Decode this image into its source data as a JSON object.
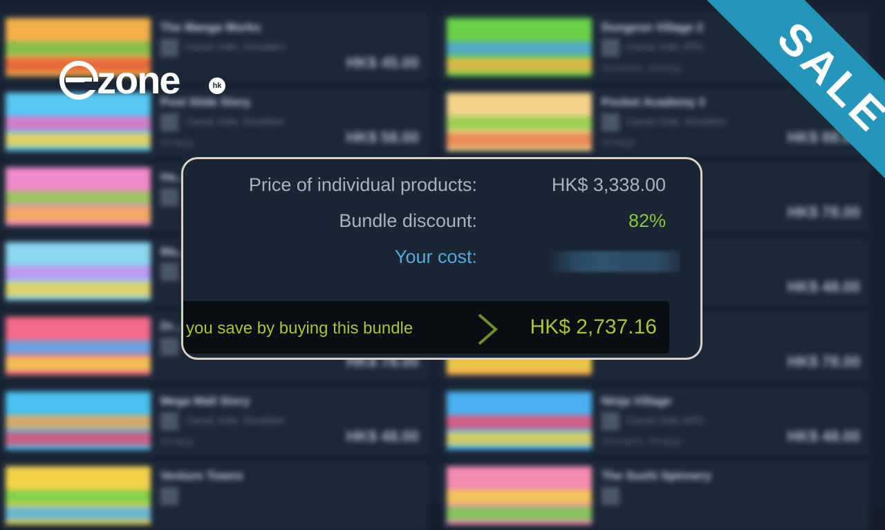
{
  "background": {
    "left_items": [
      {
        "title": "The Manga Works",
        "tags": "Casual, Indie, Simulation",
        "tag2": "",
        "price": "HK$ 45.00",
        "colors": [
          "#f2b04a",
          "#6cc04a",
          "#e45a3a"
        ]
      },
      {
        "title": "Pool Slide Story",
        "tags": "Casual, Indie, Simulation",
        "tag2": "Strategy",
        "price": "HK$ 58.00",
        "colors": [
          "#58c8f0",
          "#f06cc0",
          "#ffd24a"
        ]
      },
      {
        "title": "Ha...",
        "tags": "",
        "tag2": "",
        "price": "",
        "colors": [
          "#f08ac8",
          "#8ad04a",
          "#f2b24a"
        ]
      },
      {
        "title": "Ma...",
        "tags": "",
        "tag2": "",
        "price": "",
        "colors": [
          "#8ad4f0",
          "#c88af0",
          "#f2d24a"
        ]
      },
      {
        "title": "Dr...",
        "tags": "",
        "tag2": "",
        "price": "HK$ 78.00",
        "colors": [
          "#f26a8a",
          "#4ab0f0",
          "#f2d24a"
        ]
      },
      {
        "title": "Mega Mall Story",
        "tags": "Casual, Indie, Simulation",
        "tag2": "Strategy",
        "price": "HK$ 48.00",
        "colors": [
          "#4ac0f0",
          "#f2a44a",
          "#e84a6a"
        ]
      },
      {
        "title": "Venture Towns",
        "tags": "",
        "tag2": "",
        "price": "",
        "colors": [
          "#f2d24a",
          "#6ad04a",
          "#4ab0f0"
        ]
      }
    ],
    "right_items": [
      {
        "title": "Dungeon Village 2",
        "tags": "Casual, Indie, RPG",
        "tag2": "Simulation, Strategy",
        "price": "",
        "colors": [
          "#6ad04a",
          "#4aa0e0",
          "#f2b24a"
        ]
      },
      {
        "title": "Pocket Academy 3",
        "tags": "Casual, Indie, Simulation",
        "tag2": "Strategy",
        "price": "HK$ 88.00",
        "colors": [
          "#f2d28a",
          "#8ad04a",
          "#e87a4a"
        ]
      },
      {
        "title": "",
        "tags": "",
        "tag2": "",
        "price": "HK$ 78.00",
        "colors": [
          "#2a3a4a",
          "#2a3a4a",
          "#2a3a4a"
        ]
      },
      {
        "title": "",
        "tags": "",
        "tag2": "",
        "price": "HK$ 48.00",
        "colors": [
          "#2a3a4a",
          "#2a3a4a",
          "#2a3a4a"
        ]
      },
      {
        "title": "",
        "tags": "",
        "tag2": "",
        "price": "HK$ 78.00",
        "colors": [
          "#f2a44a",
          "#6ad04a",
          "#e8d04a"
        ]
      },
      {
        "title": "Ninja Village",
        "tags": "Casual, Indie, RPG",
        "tag2": "Simulation, Strategy",
        "price": "HK$ 48.00",
        "colors": [
          "#4ab0f0",
          "#f24a6a",
          "#f2d24a"
        ]
      },
      {
        "title": "The Sushi Spinnery",
        "tags": "",
        "tag2": "",
        "price": "",
        "colors": [
          "#f28ab0",
          "#f2d24a",
          "#6ad04a"
        ]
      }
    ]
  },
  "logo": {
    "main": "zone",
    "suffix": "hk"
  },
  "ribbon": {
    "text": "SALE"
  },
  "bundle": {
    "price_label": "Price of individual products:",
    "price_value": "HK$ 3,338.00",
    "discount_label": "Bundle discount:",
    "discount_value": "82%",
    "cost_label": "Your cost:",
    "save_text": "you save by buying this bundle",
    "save_amount": "HK$ 2,737.16"
  },
  "colors": {
    "discount": "#8bc53f",
    "cost_label": "#56a8d6",
    "save_text": "#a4c639",
    "ribbon": "#2596b9"
  }
}
